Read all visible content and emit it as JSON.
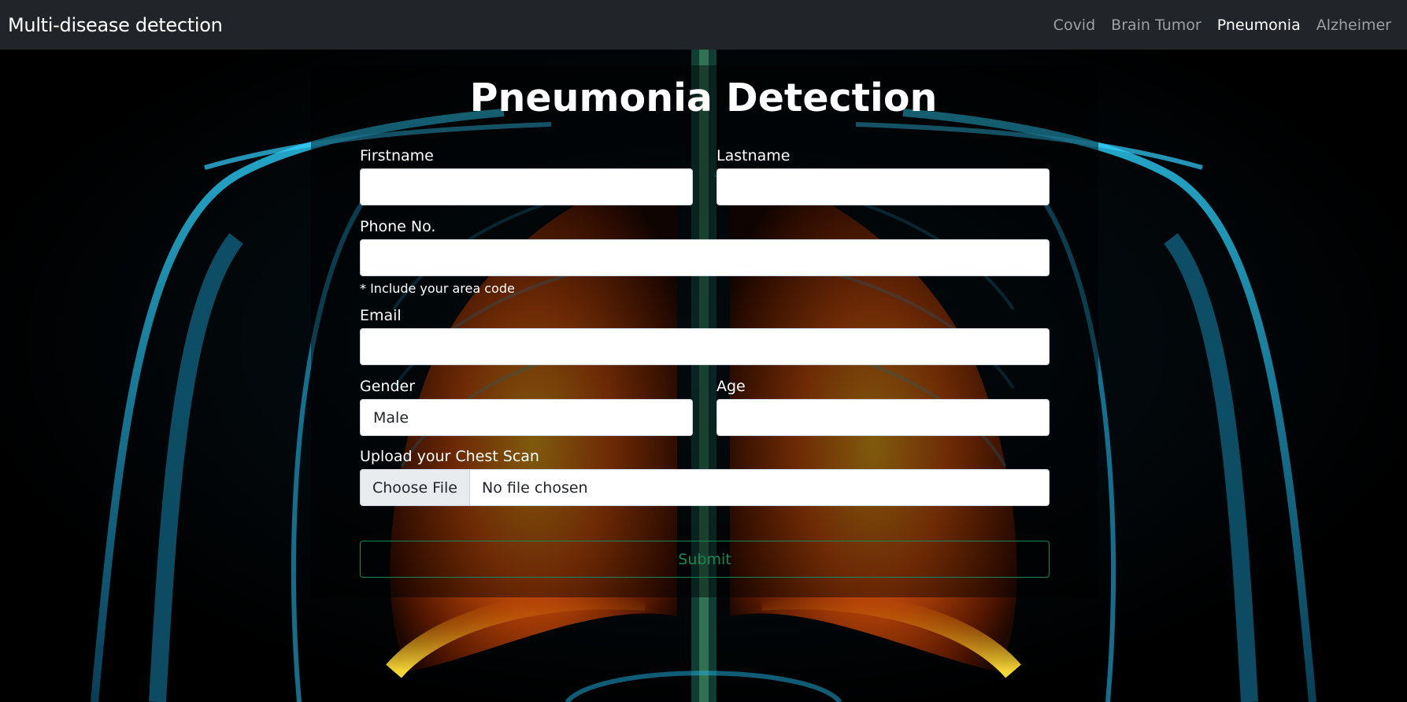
{
  "navbar": {
    "brand": "Multi-disease detection",
    "links": [
      {
        "label": "Covid",
        "active": false
      },
      {
        "label": "Brain Tumor",
        "active": false
      },
      {
        "label": "Pneumonia",
        "active": true
      },
      {
        "label": "Alzheimer",
        "active": false
      }
    ]
  },
  "form": {
    "title": "Pneumonia Detection",
    "firstname_label": "Firstname",
    "firstname_value": "",
    "lastname_label": "Lastname",
    "lastname_value": "",
    "phone_label": "Phone No.",
    "phone_value": "",
    "phone_help": "* Include your area code",
    "email_label": "Email",
    "email_value": "",
    "gender_label": "Gender",
    "gender_value": "Male",
    "age_label": "Age",
    "age_value": "",
    "upload_label": "Upload your Chest Scan",
    "choose_file": "Choose File",
    "file_status": "No file chosen",
    "submit": "Submit"
  },
  "colors": {
    "navbar_bg": "#212529",
    "submit_outline": "#198754",
    "lung_glow": "#ff7a10",
    "skeleton_glow": "#1fb5e8"
  }
}
